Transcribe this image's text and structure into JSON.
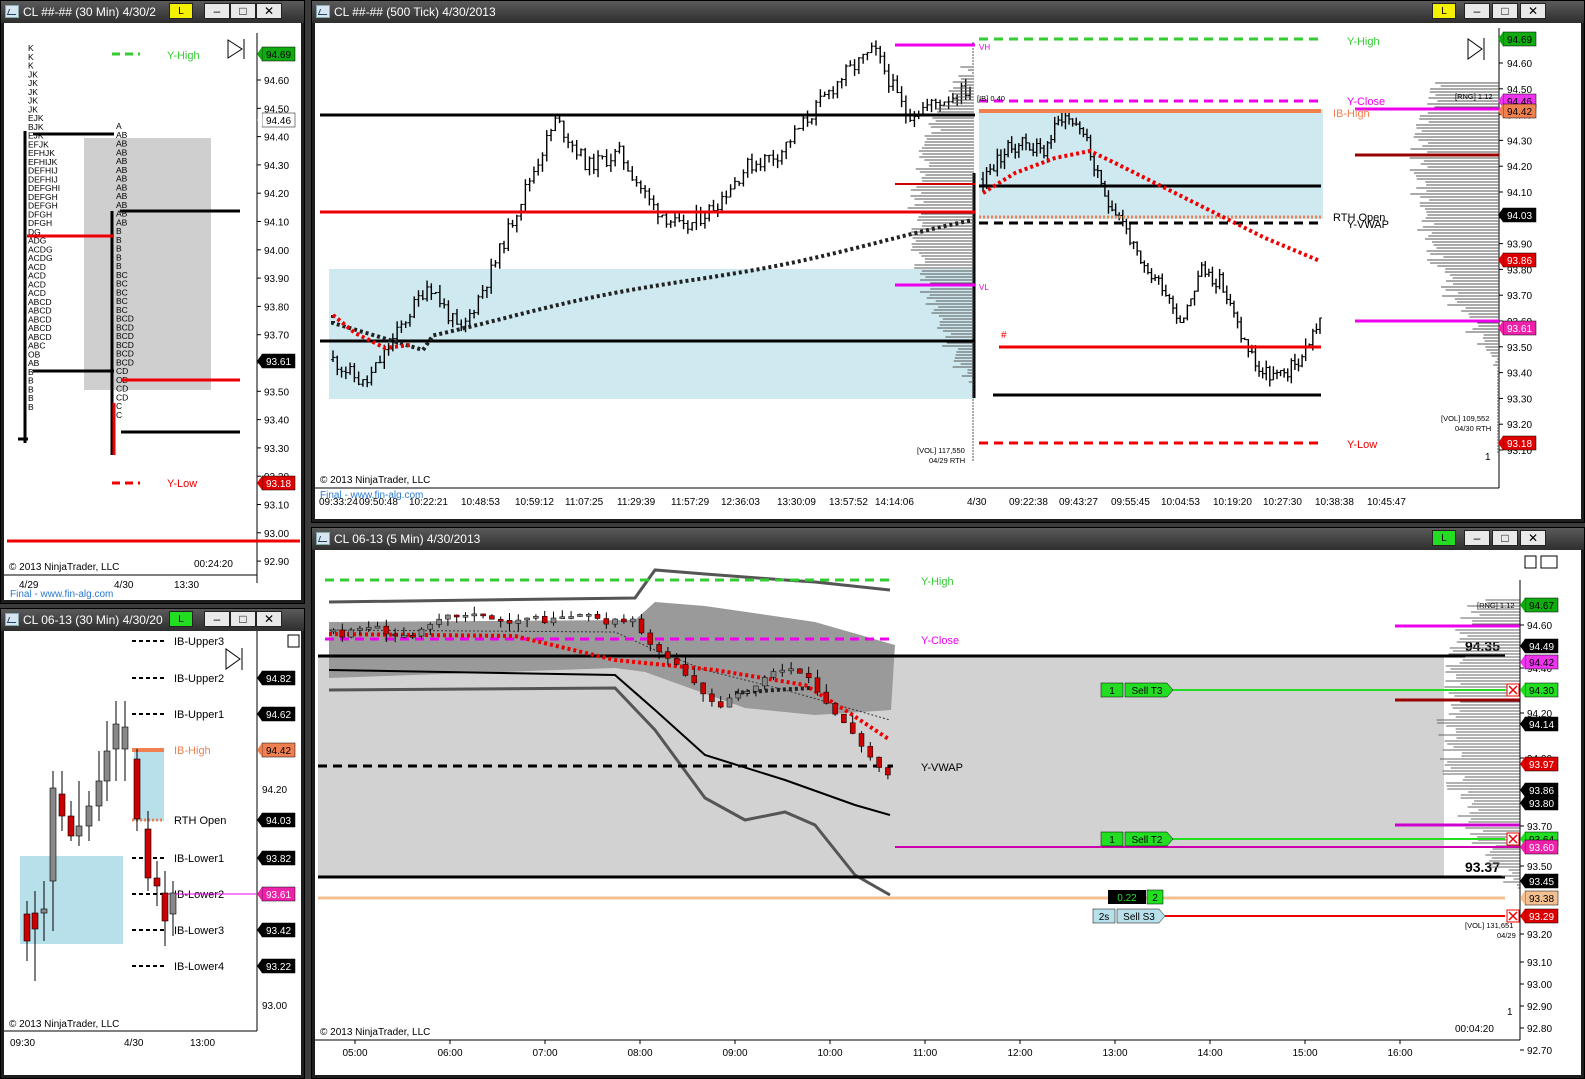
{
  "windows": {
    "w1": {
      "title": "CL ##-## (30 Min)  4/30/2",
      "account_badge": "L",
      "copyright": "© 2013 NinjaTrader, LLC",
      "timer": "00:24:20",
      "watermark": "Final - www.fin-alg.com",
      "price_labels": [
        "94.60",
        "94.50",
        "94.40",
        "94.30",
        "94.20",
        "94.10",
        "94.00",
        "93.90",
        "93.80",
        "93.70",
        "93.60",
        "93.50",
        "93.40",
        "93.30",
        "93.20",
        "93.10",
        "93.00",
        "92.90"
      ],
      "tags": {
        "y_high_price": "94.69",
        "last_price": "94.46",
        "poc_price": "93.61",
        "y_low_price": "93.18"
      },
      "lines": {
        "y_high": "Y-High",
        "y_low": "Y-Low"
      },
      "time_labels": [
        "4/29",
        "4/30",
        "13:30"
      ],
      "tpo_letters": [
        "K",
        "K",
        "K",
        "JK",
        "JK",
        "JK",
        "JK",
        "JK",
        "EJK",
        "BJK",
        "EJK",
        "EFJK",
        "EFHJK",
        "EFHIJK",
        "DEFHIJ",
        "DEFHIJ",
        "DEFGHI",
        "DEFGH",
        "DEFGH",
        "DFGH",
        "DFGH",
        "DG",
        "ADG",
        "ACDG",
        "ACDG",
        "ACD",
        "ACD",
        "ACD",
        "ACD",
        "ABCD",
        "ABCD",
        "ABCD",
        "ABCD",
        "ABCD",
        "ABC",
        "OB",
        "AB",
        "B",
        "B",
        "B",
        "B",
        "B"
      ],
      "tpo_letters_2": [
        "A",
        "AB",
        "AB",
        "AB",
        "AB",
        "AB",
        "AB",
        "AB",
        "AB",
        "AB",
        "AB",
        "AB",
        "B",
        "B",
        "B",
        "B",
        "B",
        "BC",
        "BC",
        "BC",
        "BC",
        "BC",
        "BCD",
        "BCD",
        "BCD",
        "BCD",
        "BCD",
        "BCD",
        "CD",
        "CD",
        "CD",
        "CD",
        "C",
        "C"
      ]
    },
    "w2": {
      "title": "CL ##-## (500 Tick)  4/30/2013",
      "account_badge": "L",
      "copyright": "© 2013 NinjaTrader, LLC",
      "watermark": "Final - www.fin-alg.com",
      "price_labels": [
        "94.60",
        "94.50",
        "94.40",
        "94.30",
        "94.20",
        "94.10",
        "94.00",
        "93.90",
        "93.80",
        "93.70",
        "93.60",
        "93.50",
        "93.40",
        "93.30",
        "93.20",
        "93.10"
      ],
      "tags": {
        "y_high_price": "94.69",
        "y_close_price": "94.46",
        "ib_high_price": "94.42",
        "rth_open_price": "94.03",
        "vwap_price": "93.86",
        "last_price": "93.61",
        "y_low_price": "93.18"
      },
      "lines": {
        "y_high": "Y-High",
        "y_close": "Y-Close",
        "ib_high": "IB-High",
        "rth_open": "RTH Open",
        "y_vwap": "Y-VWAP",
        "y_low": "Y-Low",
        "vh": "VH",
        "vl": "VL",
        "hash": "#"
      },
      "notes": {
        "ib_range": "[IB] 0.40",
        "rng": "[RNG] 1.12",
        "vol_prev": "[VOL] 117,550",
        "vol_prev_date": "04/29 RTH",
        "vol_cur": "[VOL] 109,552",
        "vol_cur_date": "04/30 RTH",
        "one": "1"
      },
      "time_labels": [
        "09:33:24",
        "09:50:48",
        "10:22:21",
        "10:48:53",
        "10:59:12",
        "11:07:25",
        "11:29:39",
        "11:57:29",
        "12:36:03",
        "13:30:09",
        "13:57:52",
        "14:14:06",
        "4/30",
        "09:22:38",
        "09:43:27",
        "09:55:45",
        "10:04:53",
        "10:19:20",
        "10:27:30",
        "10:38:38",
        "10:45:47"
      ]
    },
    "w3": {
      "title": "CL 06-13 (30 Min)  4/30/20",
      "account_badge": "L",
      "copyright": "© 2013 NinjaTrader, LLC",
      "price_labels": [
        "94.20",
        "93.00"
      ],
      "levels": [
        {
          "label": "IB-Upper3",
          "price": ""
        },
        {
          "label": "IB-Upper2",
          "price": "94.82"
        },
        {
          "label": "IB-Upper1",
          "price": "94.62"
        },
        {
          "label": "IB-High",
          "price": "94.42"
        },
        {
          "label": "RTH Open",
          "price": "94.03"
        },
        {
          "label": "IB-Lower1",
          "price": "93.82"
        },
        {
          "label": "IB-Lower2",
          "price": "93.61"
        },
        {
          "label": "IB-Lower3",
          "price": "93.42"
        },
        {
          "label": "IB-Lower4",
          "price": "93.22"
        }
      ],
      "time_labels": [
        "09:30",
        "4/30",
        "13:00"
      ]
    },
    "w4": {
      "title": "CL 06-13 (5 Min)  4/30/2013",
      "account_badge": "L",
      "copyright": "© 2013 NinjaTrader, LLC",
      "timer": "00:04:20",
      "price_labels": [
        "94.60",
        "94.40",
        "94.20",
        "94.00",
        "93.70",
        "93.50",
        "93.20",
        "93.10",
        "93.00",
        "92.90",
        "92.80",
        "92.70"
      ],
      "tags": {
        "y_high_price": "94.67",
        "p1": "94.49",
        "y_close_price": "94.42",
        "t3_price": "94.30",
        "p2": "94.14",
        "p3": "93.97",
        "p4": "93.86",
        "p5": "93.80",
        "t2_price": "93.64",
        "last_price": "93.60",
        "p6": "93.45",
        "entry_price": "93.38",
        "stop_price": "93.29"
      },
      "lines": {
        "y_high": "Y-High",
        "y_close": "Y-Close",
        "y_vwap": "Y-VWAP"
      },
      "big_prices": {
        "upper": "94.35",
        "lower": "93.37"
      },
      "orders": {
        "t3_qty": "1",
        "t3_label": "Sell T3",
        "t2_qty": "1",
        "t2_label": "Sell T2",
        "pos_pnl": "0.22",
        "pos_qty": "2",
        "s3_qty": "2s",
        "s3_label": "Sell S3"
      },
      "notes": {
        "rng": "[RNG] 1.12",
        "vol": "[VOL] 131,651",
        "vol_date": "04/29",
        "one": "1"
      },
      "time_labels": [
        "05:00",
        "06:00",
        "07:00",
        "08:00",
        "09:00",
        "10:00",
        "11:00",
        "12:00",
        "13:00",
        "14:00",
        "15:00",
        "16:00"
      ]
    }
  },
  "colors": {
    "up_bar": "#888888",
    "down_bar": "#cc0000",
    "y_high": "#33cc33",
    "y_close": "#ff22ff",
    "ib_high": "#f08050",
    "red_line": "#ee0000",
    "vwap_dots": "#222222",
    "band_fill": "#cfe9f0",
    "gray_fill": "#c8c8c8",
    "order_green": "#22dd22"
  }
}
